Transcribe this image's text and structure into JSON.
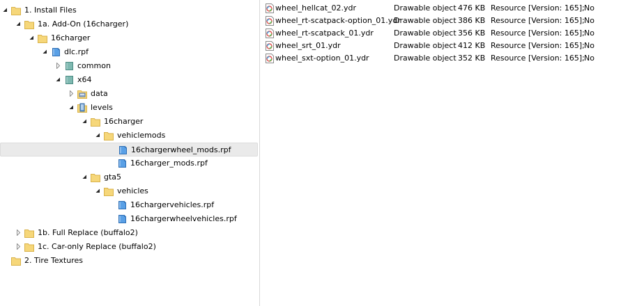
{
  "tree": [
    {
      "label": "1. Install Files",
      "icon": "folder-icon",
      "expander": "expanded-arrow",
      "level": 0
    },
    {
      "label": "1a. Add-On (16charger)",
      "icon": "folder-icon",
      "expander": "expanded-arrow",
      "level": 1
    },
    {
      "label": "16charger",
      "icon": "folder-icon",
      "expander": "expanded-arrow",
      "level": 2
    },
    {
      "label": "dlc.rpf",
      "icon": "rpf-archive-icon",
      "expander": "expanded-arrow",
      "level": 3
    },
    {
      "label": "common",
      "icon": "rpf-folder-icon",
      "expander": "collapsed-arrow",
      "level": 4
    },
    {
      "label": "x64",
      "icon": "rpf-folder-icon",
      "expander": "expanded-arrow",
      "level": 4
    },
    {
      "label": "data",
      "icon": "folder-data-icon",
      "expander": "collapsed-arrow",
      "level": 5
    },
    {
      "label": "levels",
      "icon": "folder-levels-icon",
      "expander": "expanded-arrow",
      "level": 5
    },
    {
      "label": "16charger",
      "icon": "folder-icon",
      "expander": "expanded-arrow",
      "level": 6
    },
    {
      "label": "vehiclemods",
      "icon": "folder-icon",
      "expander": "expanded-arrow",
      "level": 7
    },
    {
      "label": "16chargerwheel_mods.rpf",
      "icon": "rpf-archive-icon",
      "expander": "none",
      "level": 8,
      "selected": true
    },
    {
      "label": "16charger_mods.rpf",
      "icon": "rpf-archive-icon",
      "expander": "none",
      "level": 8
    },
    {
      "label": "gta5",
      "icon": "folder-icon",
      "expander": "expanded-arrow",
      "level": 6
    },
    {
      "label": "vehicles",
      "icon": "folder-icon",
      "expander": "expanded-arrow",
      "level": 7
    },
    {
      "label": "16chargervehicles.rpf",
      "icon": "rpf-archive-icon",
      "expander": "none",
      "level": 8
    },
    {
      "label": "16chargerwheelvehicles.rpf",
      "icon": "rpf-archive-icon",
      "expander": "none",
      "level": 8
    },
    {
      "label": "1b. Full Replace (buffalo2)",
      "icon": "folder-icon",
      "expander": "collapsed-arrow",
      "level": 1
    },
    {
      "label": "1c. Car-only Replace (buffalo2)",
      "icon": "folder-icon",
      "expander": "collapsed-arrow",
      "level": 1
    },
    {
      "label": "2. Tire Textures",
      "icon": "folder-icon",
      "expander": "none",
      "level": 0
    }
  ],
  "files": [
    {
      "name": "wheel_hellcat_02.ydr",
      "type": "Drawable object",
      "size": "476 KB",
      "attributes": "Resource [Version: 165];",
      "encrypted": "No",
      "icon": "drawable-file-icon"
    },
    {
      "name": "wheel_rt-scatpack-option_01.ydr",
      "type": "Drawable object",
      "size": "386 KB",
      "attributes": "Resource [Version: 165];",
      "encrypted": "No",
      "icon": "drawable-file-icon"
    },
    {
      "name": "wheel_rt-scatpack_01.ydr",
      "type": "Drawable object",
      "size": "356 KB",
      "attributes": "Resource [Version: 165];",
      "encrypted": "No",
      "icon": "drawable-file-icon"
    },
    {
      "name": "wheel_srt_01.ydr",
      "type": "Drawable object",
      "size": "412 KB",
      "attributes": "Resource [Version: 165];",
      "encrypted": "No",
      "icon": "drawable-file-icon"
    },
    {
      "name": "wheel_sxt-option_01.ydr",
      "type": "Drawable object",
      "size": "352 KB",
      "attributes": "Resource [Version: 165];",
      "encrypted": "No",
      "icon": "drawable-file-icon"
    }
  ],
  "colors": {
    "folder": "#f6d77a",
    "folder_edge": "#d9b24a",
    "rpf_archive": "#5aa0e6",
    "rpf_folder": "#7fb9b1",
    "selection": "#eaeaea"
  }
}
